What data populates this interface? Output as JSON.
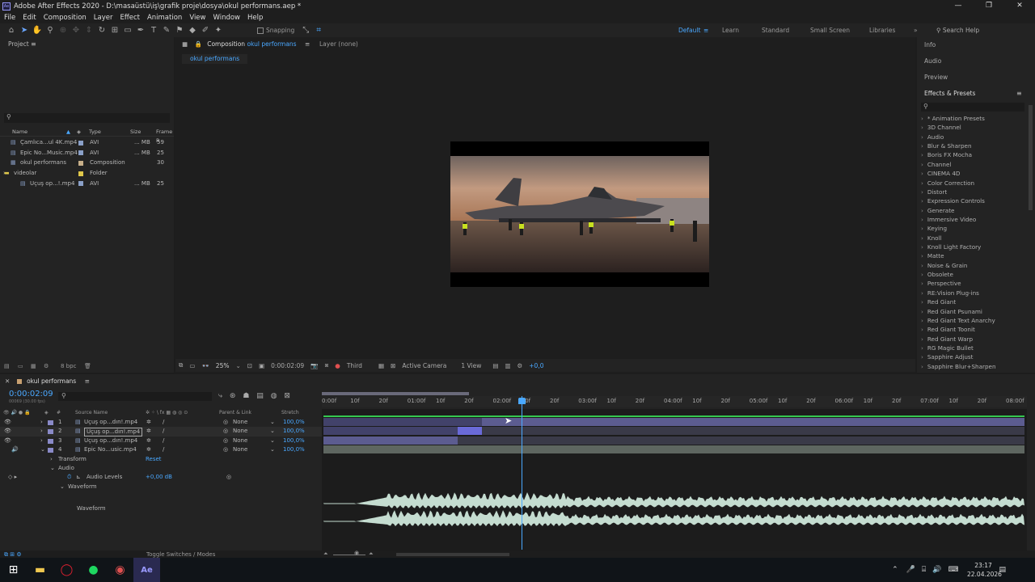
{
  "window": {
    "title": "Adobe After Effects 2020 - D:\\masaüstü\\iş\\grafik proje\\dosya\\okul performans.aep *",
    "icon": "Ae"
  },
  "menu": [
    "File",
    "Edit",
    "Composition",
    "Layer",
    "Effect",
    "Animation",
    "View",
    "Window",
    "Help"
  ],
  "toolbar": {
    "snapping_label": "Snapping"
  },
  "workspaces": [
    "Default",
    "Learn",
    "Standard",
    "Small Screen",
    "Libraries"
  ],
  "search_help": "Search Help",
  "project": {
    "title": "Project",
    "columns": [
      "Name",
      "Type",
      "Size",
      "Frame R"
    ],
    "rows": [
      {
        "name": "Çamlıca...ul 4K.mp4",
        "type": "AVI",
        "size": "... MB",
        "fr": "59",
        "color": "#8aa0c8"
      },
      {
        "name": "Epic No...Music.mp4",
        "type": "AVI",
        "size": "... MB",
        "fr": "25",
        "color": "#8aa0c8"
      },
      {
        "name": "okul performans",
        "type": "Composition",
        "size": "",
        "fr": "30",
        "color": "#c8b08a"
      },
      {
        "name": "videolar",
        "type": "Folder",
        "size": "",
        "fr": "",
        "color": "#e0c84a"
      },
      {
        "name": "Uçuş op...!.mp4",
        "type": "AVI",
        "size": "... MB",
        "fr": "25",
        "color": "#8aa0c8"
      }
    ],
    "bpc": "8 bpc"
  },
  "composition": {
    "tab_label": "Composition",
    "tab_name": "okul performans",
    "layer_tab": "Layer (none)",
    "crumb": "okul performans",
    "zoom": "25%",
    "timecode": "0:00:02:09",
    "resolution": "Third",
    "camera": "Active Camera",
    "views": "1 View",
    "exposure": "+0,0"
  },
  "right_panel": {
    "info": "Info",
    "audio": "Audio",
    "preview": "Preview",
    "effects_title": "Effects & Presets",
    "effects": [
      "* Animation Presets",
      "3D Channel",
      "Audio",
      "Blur & Sharpen",
      "Boris FX Mocha",
      "Channel",
      "CINEMA 4D",
      "Color Correction",
      "Distort",
      "Expression Controls",
      "Generate",
      "Immersive Video",
      "Keying",
      "Knoll",
      "Knoll Light Factory",
      "Matte",
      "Noise & Grain",
      "Obsolete",
      "Perspective",
      "RE:Vision Plug-ins",
      "Red Giant",
      "Red Giant Psunami",
      "Red Giant Text Anarchy",
      "Red Giant Toonit",
      "Red Giant Warp",
      "RG Magic Bullet",
      "Sapphire Adjust",
      "Sapphire Blur+Sharpen"
    ]
  },
  "timeline": {
    "comp_name": "okul performans",
    "timecode": "0:00:02:09",
    "fps": "00069 (30.00 fps)",
    "col_source": "Source Name",
    "col_parent": "Parent & Link",
    "col_stretch": "Stretch",
    "ruler": [
      "0:00f",
      "10f",
      "20f",
      "01:00f",
      "10f",
      "20f",
      "02:00f",
      "10f",
      "20f",
      "03:00f",
      "10f",
      "20f",
      "04:00f",
      "10f",
      "20f",
      "05:00f",
      "10f",
      "20f",
      "06:00f",
      "10f",
      "20f",
      "07:00f",
      "10f",
      "20f",
      "08:00f"
    ],
    "layers": [
      {
        "num": "1",
        "name": "Uçuş op...dın!.mp4",
        "parent": "None",
        "stretch": "100,0%"
      },
      {
        "num": "2",
        "name": "Uçuş op...dın!.mp4",
        "parent": "None",
        "stretch": "100,0%"
      },
      {
        "num": "3",
        "name": "Uçuş op...dın!.mp4",
        "parent": "None",
        "stretch": "100,0%"
      },
      {
        "num": "4",
        "name": "Epic No...usic.mp4",
        "parent": "None",
        "stretch": "100,0%"
      }
    ],
    "transform": "Transform",
    "reset": "Reset",
    "audio": "Audio",
    "audio_levels": "Audio Levels",
    "audio_levels_val": "+0,00 dB",
    "waveform_group": "Waveform",
    "waveform_label": "Waveform",
    "toggle": "Toggle Switches / Modes"
  },
  "taskbar": {
    "time": "23:17",
    "date": "22.04.2026"
  }
}
